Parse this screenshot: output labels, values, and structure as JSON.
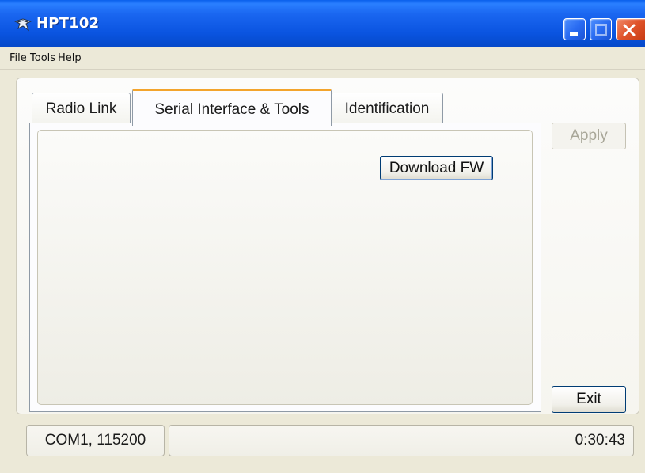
{
  "window": {
    "title": "HPT102",
    "app_icon": "hpt102-app-icon",
    "title_bar_color": "#0a54e0",
    "close_button_color": "#e0542b"
  },
  "menu": {
    "file": {
      "prefix": "",
      "accel": "F",
      "rest": "ile"
    },
    "tools": {
      "prefix": "",
      "accel": "T",
      "rest": "ools"
    },
    "help": {
      "prefix": "",
      "accel": "H",
      "rest": "elp"
    }
  },
  "tabs": [
    {
      "label": "Radio Link",
      "selected": false
    },
    {
      "label": "Serial Interface & Tools",
      "selected": true
    },
    {
      "label": "Identification",
      "selected": false
    }
  ],
  "tab_accent_color": "#f3a42c",
  "buttons": {
    "download_fw": "Download FW",
    "apply": "Apply",
    "apply_enabled": false,
    "exit": "Exit"
  },
  "status": {
    "port": "COM1, 115200",
    "time": "0:30:43"
  }
}
